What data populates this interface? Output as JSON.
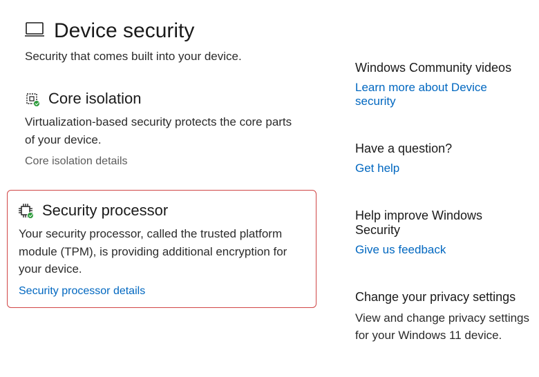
{
  "page": {
    "title": "Device security",
    "subtitle": "Security that comes built into your device."
  },
  "sections": {
    "coreIsolation": {
      "title": "Core isolation",
      "description": "Virtualization-based security protects the core parts of your device.",
      "link": "Core isolation details"
    },
    "securityProcessor": {
      "title": "Security processor",
      "description": "Your security processor, called the trusted platform module (TPM), is providing additional encryption for your device.",
      "link": "Security processor details"
    }
  },
  "sidebar": {
    "videos": {
      "title": "Windows Community videos",
      "link": "Learn more about Device security"
    },
    "question": {
      "title": "Have a question?",
      "link": "Get help"
    },
    "improve": {
      "title": "Help improve Windows Security",
      "link": "Give us feedback"
    },
    "privacy": {
      "title": "Change your privacy settings",
      "text": "View and change privacy settings for your Windows 11 device."
    }
  }
}
